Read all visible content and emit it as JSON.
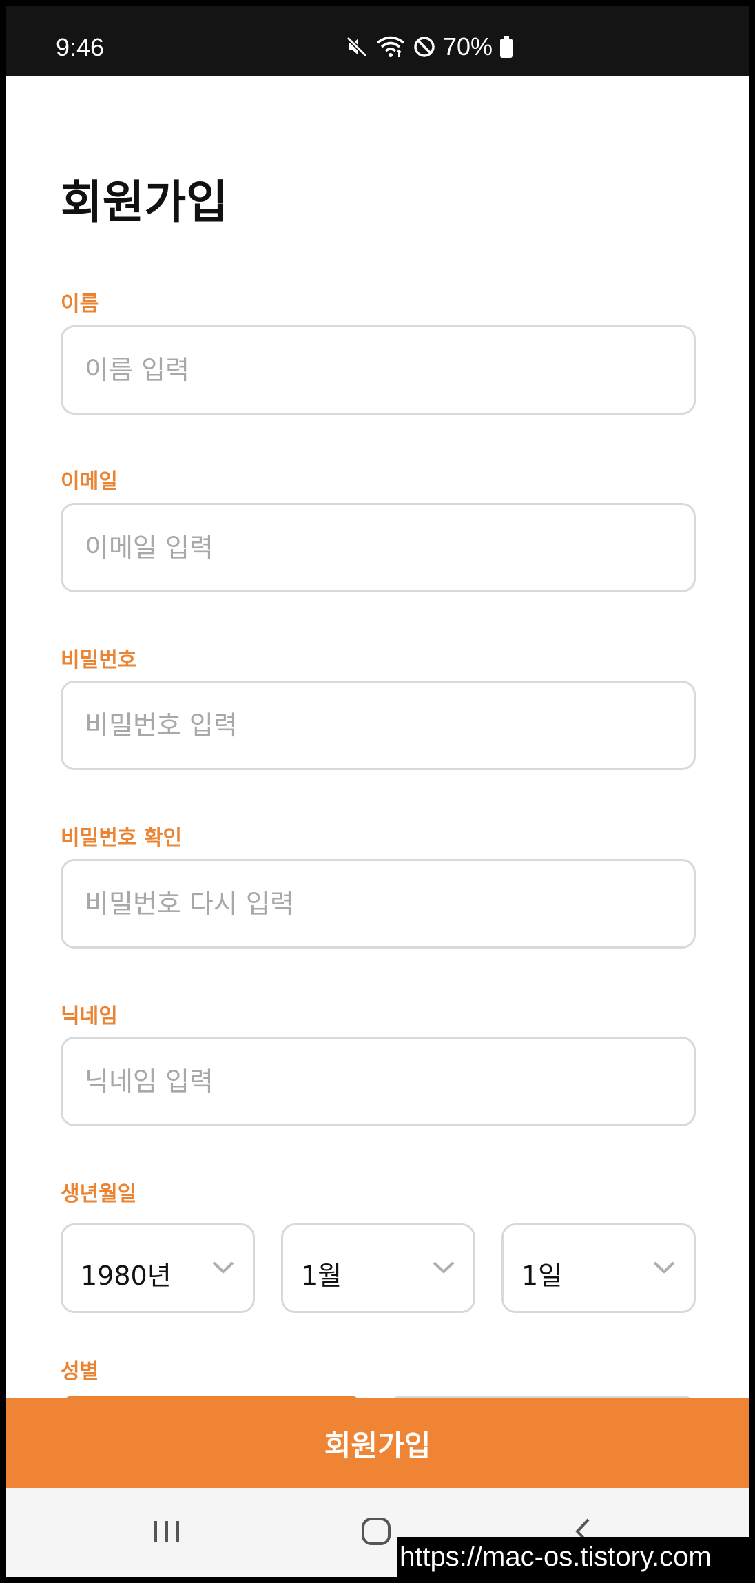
{
  "status_bar": {
    "time": "9:46",
    "battery_percent": "70%",
    "icons": [
      "mute-icon",
      "wifi-icon",
      "do-not-disturb-icon",
      "battery-icon"
    ]
  },
  "title": "회원가입",
  "fields": {
    "name": {
      "label": "이름",
      "placeholder": "이름 입력",
      "value": ""
    },
    "email": {
      "label": "이메일",
      "placeholder": "이메일 입력",
      "value": ""
    },
    "password": {
      "label": "비밀번호",
      "placeholder": "비밀번호 입력",
      "value": ""
    },
    "password_confirm": {
      "label": "비밀번호 확인",
      "placeholder": "비밀번호 다시 입력",
      "value": ""
    },
    "nickname": {
      "label": "닉네임",
      "placeholder": "닉네임 입력",
      "value": ""
    }
  },
  "birthdate": {
    "label": "생년월일",
    "year": "1980년",
    "month": "1월",
    "day": "1일"
  },
  "gender": {
    "label": "성별"
  },
  "signup_button": "회원가입",
  "nav_bar": {
    "icons": [
      "recent-apps-icon",
      "home-icon",
      "back-icon"
    ]
  },
  "watermark": "https://mac-os.tistory.com",
  "colors": {
    "accent": "#ee8434",
    "label": "#ea8433",
    "border": "#d9d9d9",
    "placeholder": "#a8a8a8"
  }
}
